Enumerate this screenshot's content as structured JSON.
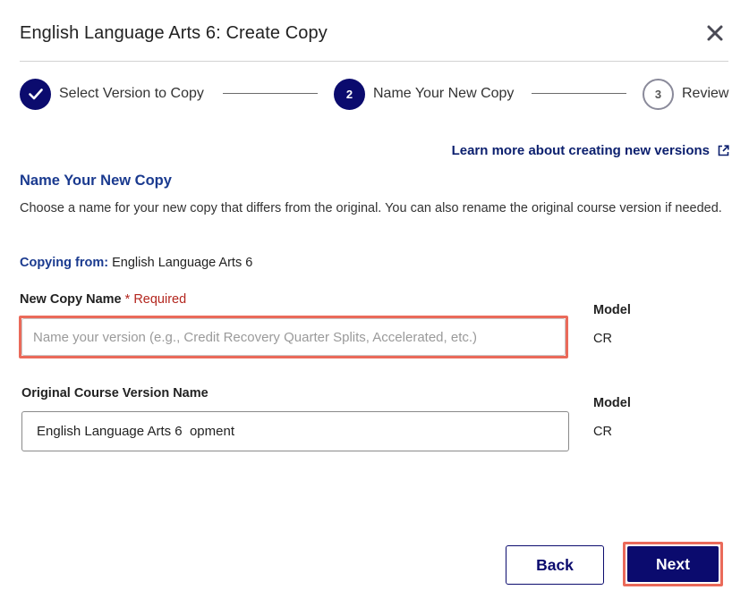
{
  "modal": {
    "title": "English Language Arts 6: Create Copy"
  },
  "stepper": {
    "steps": [
      {
        "number": "1",
        "label": "Select Version to Copy",
        "state": "done"
      },
      {
        "number": "2",
        "label": "Name Your New Copy",
        "state": "active"
      },
      {
        "number": "3",
        "label": "Review",
        "state": "todo"
      }
    ]
  },
  "learn_more": {
    "label": "Learn more about creating new versions"
  },
  "section": {
    "title": "Name Your New Copy",
    "description": "Choose a name for your new copy that differs from the original. You can also rename the original course version if needed."
  },
  "copying_from": {
    "label": "Copying from:",
    "value": "English Language Arts 6"
  },
  "new_copy": {
    "label": "New Copy Name",
    "required": "* Required",
    "value": "",
    "placeholder": "Name your version (e.g., Credit Recovery Quarter Splits, Accelerated, etc.)",
    "model_label": "Model",
    "model_value": "CR"
  },
  "original": {
    "label": "Original Course Version Name",
    "value": "English Language Arts 6  opment",
    "model_label": "Model",
    "model_value": "CR"
  },
  "footer": {
    "back_label": "Back",
    "next_label": "Next"
  },
  "colors": {
    "primary": "#0b0b6e",
    "link": "#0b1f6e",
    "heading": "#1a3a8f",
    "required": "#b3261e",
    "highlight": "#ea6a5a"
  }
}
